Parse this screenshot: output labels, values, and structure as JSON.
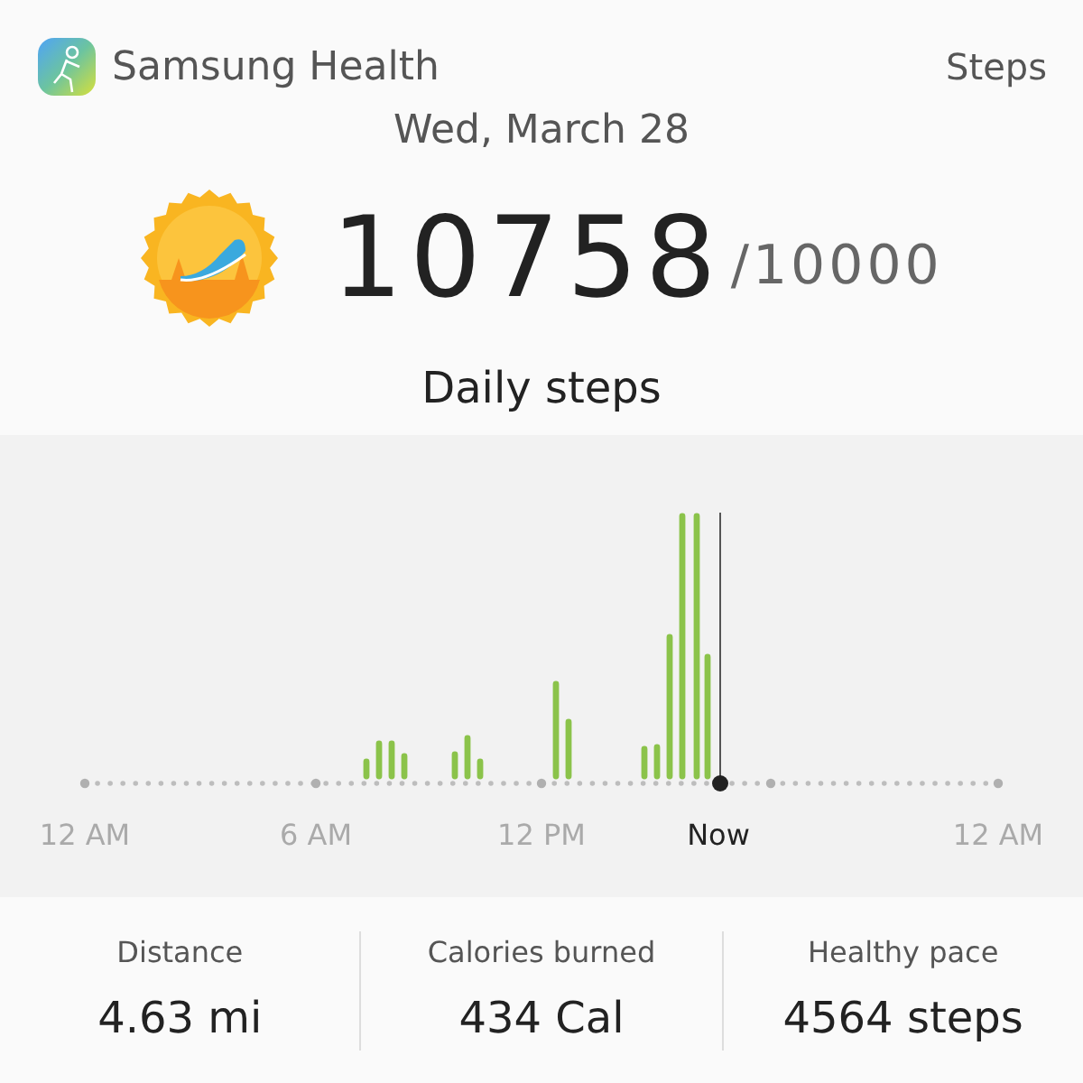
{
  "header": {
    "app_name": "Samsung Health",
    "section": "Steps"
  },
  "date": "Wed, March 28",
  "steps": {
    "count": "10758",
    "goal": "/10000",
    "label": "Daily steps"
  },
  "timeline": {
    "labels": [
      {
        "text": "12 AM",
        "kind": "tick"
      },
      {
        "text": "6 AM",
        "kind": "tick"
      },
      {
        "text": "12 PM",
        "kind": "tick"
      },
      {
        "text": "Now",
        "kind": "now"
      },
      {
        "text": "12 AM",
        "kind": "tick"
      }
    ]
  },
  "stats": [
    {
      "label": "Distance",
      "value": "4.63 mi"
    },
    {
      "label": "Calories burned",
      "value": "434 Cal"
    },
    {
      "label": "Healthy pace",
      "value": "4564 steps"
    }
  ]
}
